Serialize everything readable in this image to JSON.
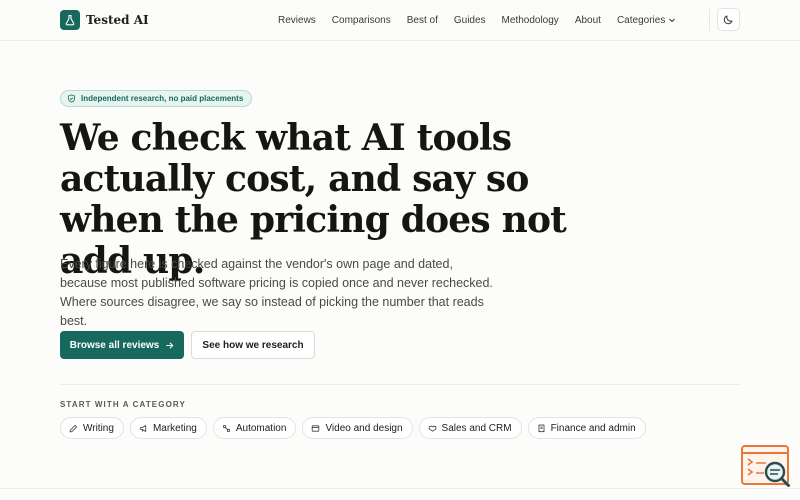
{
  "brand": {
    "name": "Tested AI",
    "accent": "#17695e"
  },
  "nav": {
    "items": [
      "Reviews",
      "Comparisons",
      "Best of",
      "Guides",
      "Methodology",
      "About"
    ],
    "categories_label": "Categories"
  },
  "theme_toggle": {
    "icon": "moon-icon"
  },
  "hero": {
    "badge": "Independent research, no paid placements",
    "headline": "We check what AI tools actually cost, and say so when the pricing does not add up.",
    "lede": "Every figure here is checked against the vendor's own page and dated, because most published software pricing is copied once and never rechecked. Where sources disagree, we say so instead of picking the number that reads best.",
    "primary_cta": "Browse all reviews",
    "secondary_cta": "See how we research"
  },
  "categories": {
    "label": "START WITH A CATEGORY",
    "items": [
      {
        "label": "Writing",
        "icon": "pen-icon"
      },
      {
        "label": "Marketing",
        "icon": "megaphone-icon"
      },
      {
        "label": "Automation",
        "icon": "workflow-icon"
      },
      {
        "label": "Video and design",
        "icon": "video-icon"
      },
      {
        "label": "Sales and CRM",
        "icon": "handshake-icon"
      },
      {
        "label": "Finance and admin",
        "icon": "receipt-icon"
      }
    ]
  },
  "help_widget": {
    "icon": "search-document-icon"
  }
}
